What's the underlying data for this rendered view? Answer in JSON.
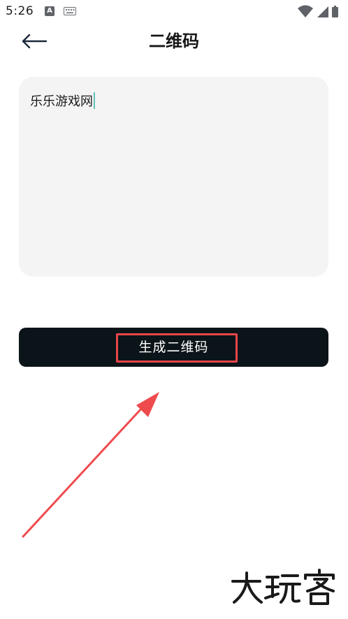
{
  "status_bar": {
    "time": "5:26",
    "app_icon_letter": "A"
  },
  "header": {
    "title": "二维码"
  },
  "input": {
    "value": "乐乐游戏网"
  },
  "actions": {
    "generate_label": "生成二维码"
  },
  "watermark": {
    "text": "大玩客"
  },
  "colors": {
    "button_bg": "#0b1418",
    "highlight": "#e8464a",
    "caret": "#66c2b8",
    "input_bg": "#f4f4f4"
  }
}
